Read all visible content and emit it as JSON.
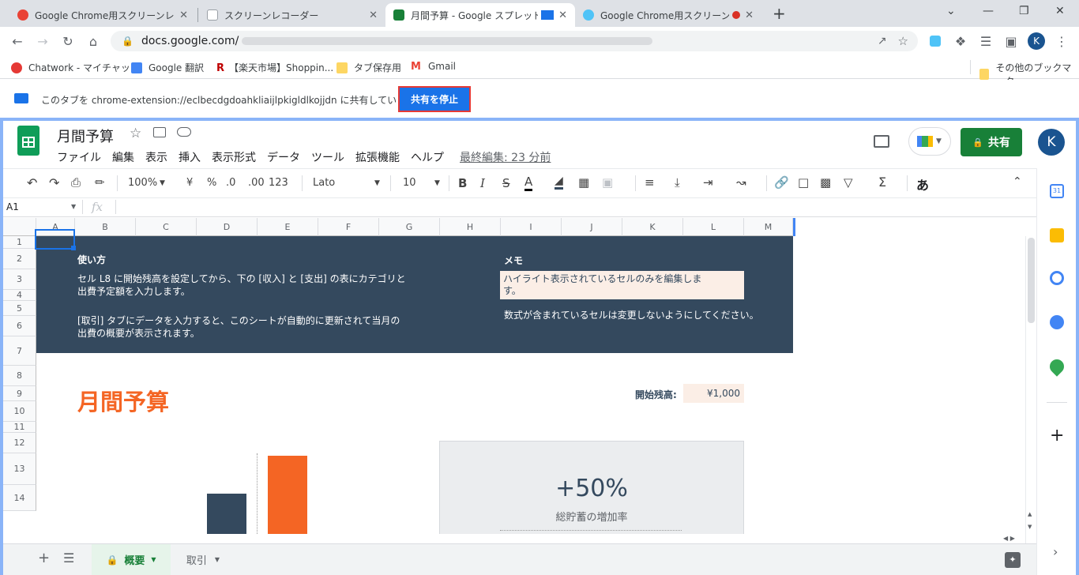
{
  "browser": {
    "tabs": [
      {
        "title": "Google Chrome用スクリーンレコーダ",
        "close": "✕",
        "favicon_color": "#e94235"
      },
      {
        "title": "スクリーンレコーダー",
        "close": "✕",
        "favicon_color": "#9aa0a6"
      },
      {
        "title": "月間予算 - Google スプレッドシ",
        "close": "✕",
        "favicon_color": "#188038"
      },
      {
        "title": "Google Chrome用スクリーンレコ",
        "close": "✕",
        "favicon_color": "#4fc3f7"
      }
    ],
    "new_tab": "+",
    "window_controls": {
      "dropdown": "⌄",
      "minimize": "—",
      "restore": "❐",
      "close": "✕"
    },
    "url": "docs.google.com/",
    "profile_initial": "K",
    "bookmarks": [
      {
        "label": "Chatwork - マイチャット",
        "icon_color": "#e53935"
      },
      {
        "label": "Google 翻訳",
        "icon_color": "#4285f4"
      },
      {
        "label": "【楽天市場】Shoppin...",
        "icon_color": "#bf0000"
      },
      {
        "label": "タブ保存用",
        "icon_color": "#fdd663"
      },
      {
        "label": "Gmail",
        "icon_color": "#ea4335"
      }
    ],
    "other_bookmarks": "その他のブックマーク"
  },
  "share_bar": {
    "message": "このタブを chrome-extension://eclbecdgdoahkliaijlpkigldlkojjdn に共有しています",
    "stop_button": "共有を停止"
  },
  "sheets": {
    "doc_title": "月間予算",
    "menu": [
      "ファイル",
      "編集",
      "表示",
      "挿入",
      "表示形式",
      "データ",
      "ツール",
      "拡張機能",
      "ヘルプ"
    ],
    "last_edit": "最終編集: 23 分前",
    "share_button": "共有",
    "avatar": "K",
    "toolbar": {
      "zoom": "100%",
      "currency": "¥",
      "percent": "%",
      "dec_decrease": ".0",
      "dec_increase": ".00",
      "more_formats": "123",
      "font": "Lato",
      "font_size": "10",
      "bold": "B",
      "italic": "I",
      "strike": "S",
      "text_color": "A",
      "input_tools": "あ"
    },
    "name_box": "A1",
    "fx": "fx",
    "columns": [
      "A",
      "B",
      "C",
      "D",
      "E",
      "F",
      "G",
      "H",
      "I",
      "J",
      "K",
      "L",
      "M"
    ],
    "rows": [
      "1",
      "2",
      "3",
      "4",
      "5",
      "6",
      "7",
      "8",
      "9",
      "10",
      "11",
      "12",
      "13",
      "14"
    ],
    "banner": {
      "howto_title": "使い方",
      "howto_line1": "セル L8 に開始残高を設定してから、下の [収入] と [支出] の表にカテゴリと",
      "howto_line2": "出費予定額を入力します。",
      "howto_line3": "[取引] タブにデータを入力すると、このシートが自動的に更新されて当月の",
      "howto_line4": "出費の概要が表示されます。",
      "memo_title": "メモ",
      "memo_highlight1": "ハイライト表示されているセルのみを編集しま",
      "memo_highlight2": "す。",
      "memo_note": "数式が含まれているセルは変更しないようにしてください。"
    },
    "budget_title": "月間予算",
    "start_balance_label": "開始残高:",
    "start_balance_value": "¥1,000",
    "savings_pct": "+50%",
    "savings_label": "総貯蓄の増加率",
    "chart_colors": {
      "planned": "#34495e",
      "actual": "#f46524"
    },
    "sheet_tabs": [
      {
        "label": "概要",
        "active": true
      },
      {
        "label": "取引",
        "active": false
      }
    ]
  }
}
